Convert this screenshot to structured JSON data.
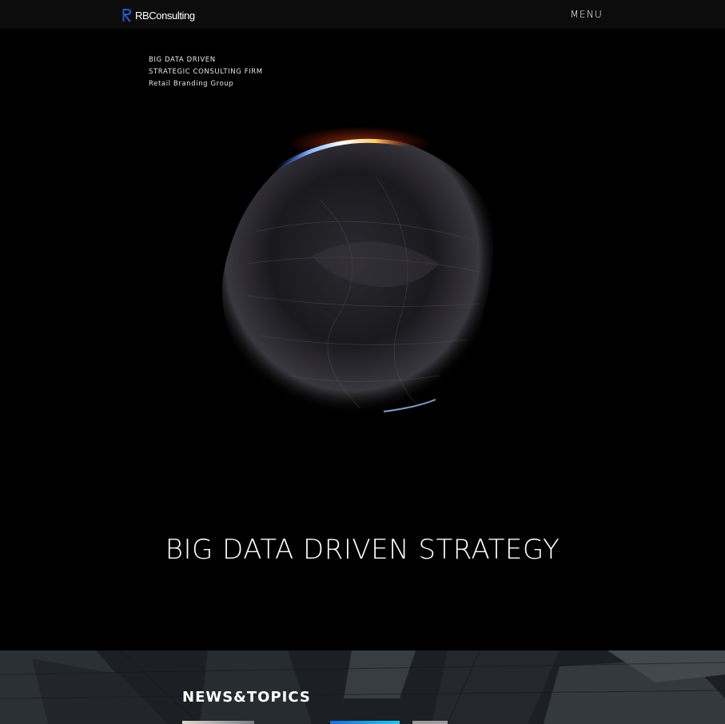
{
  "header": {
    "logo_text": "RBConsulting",
    "menu_label": "MENU"
  },
  "hero": {
    "tagline_lines": [
      "BIG DATA DRIVEN",
      "STRATEGIC CONSULTING FIRM",
      "Retail Branding Group"
    ],
    "heading": "BIG DATA DRIVEN STRATEGY"
  },
  "news": {
    "section_title": "NEWS&TOPICS"
  },
  "colors": {
    "background": "#000000",
    "header_bg": "#0c0c0c",
    "logo_mark": "#2a55c8",
    "text": "#ffffff"
  },
  "icons": {
    "logo": "rb-logo-icon"
  }
}
